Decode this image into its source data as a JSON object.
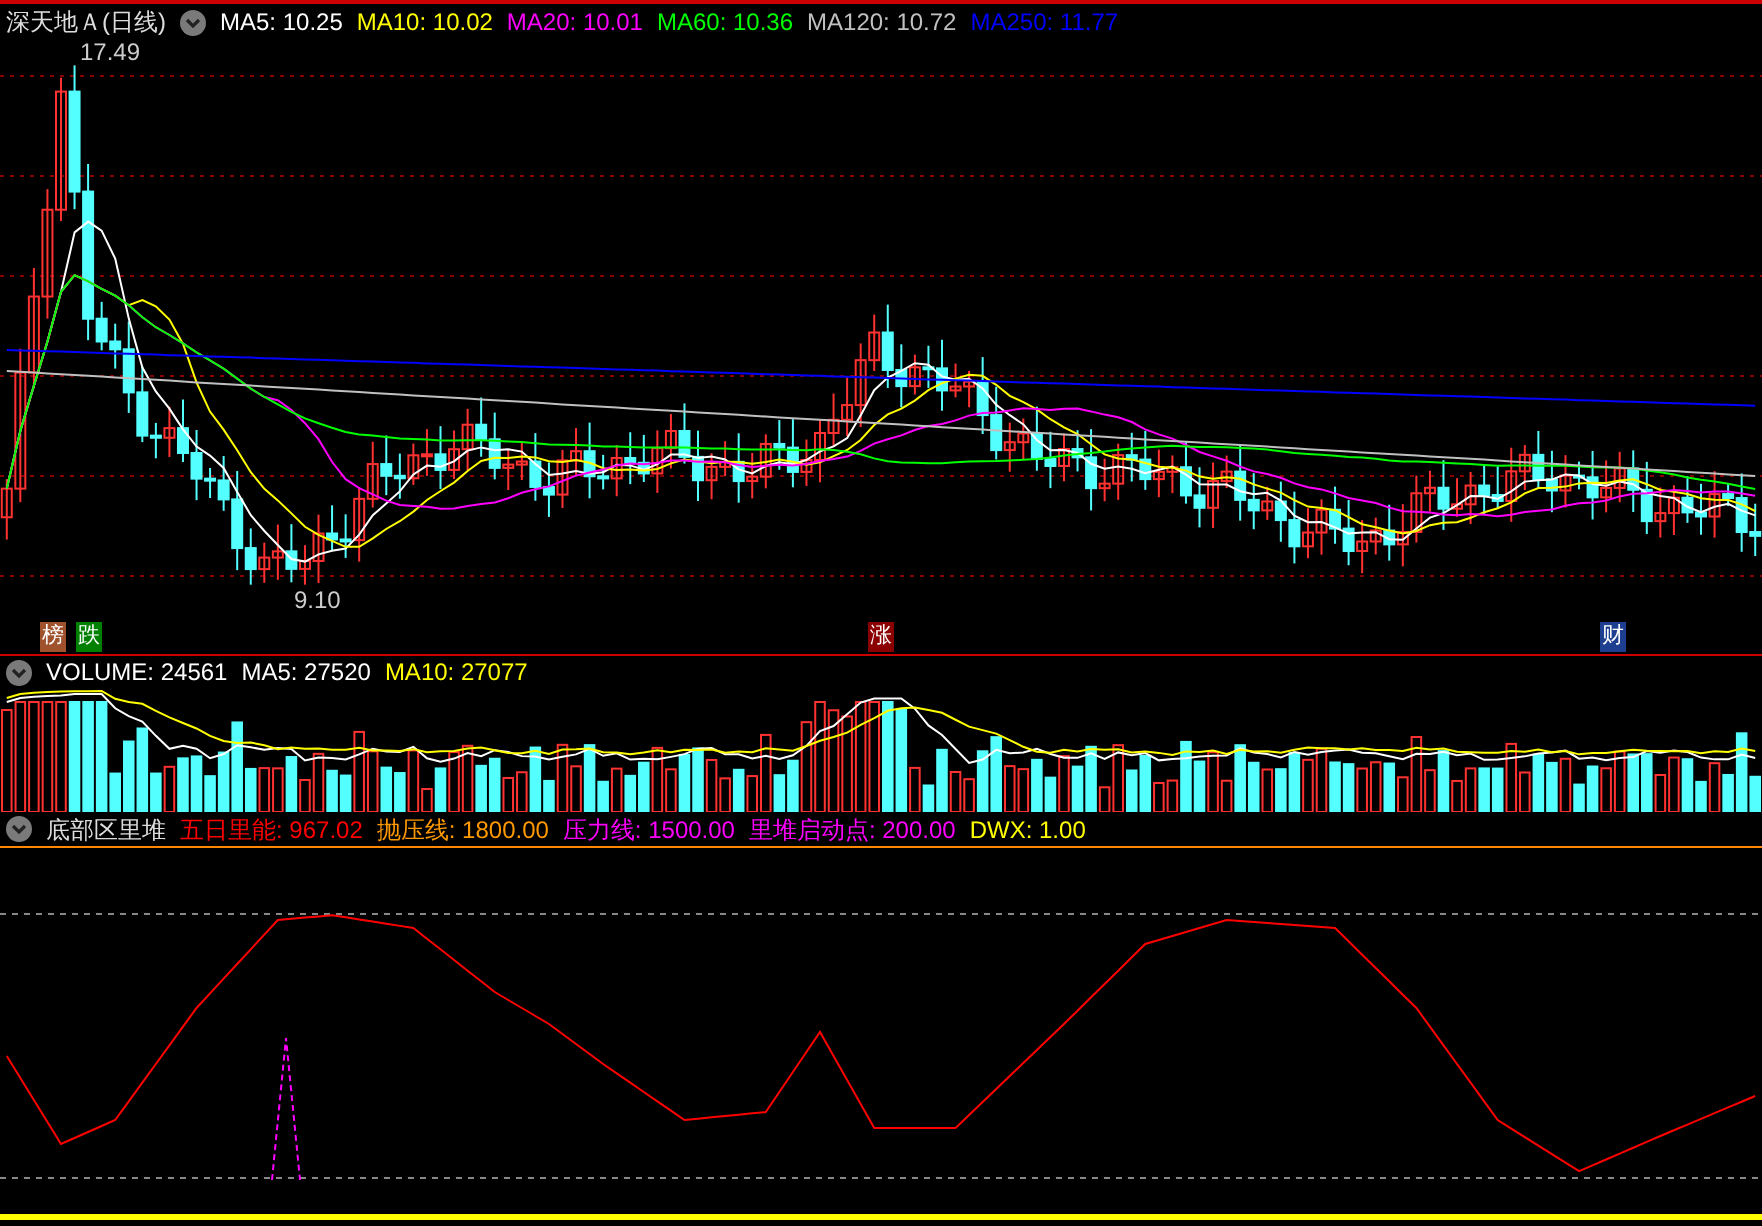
{
  "price_panel": {
    "title": "深天地Ａ(日线)",
    "indicators": [
      {
        "label": "MA5: 10.25",
        "color": "#ffffff"
      },
      {
        "label": "MA10: 10.02",
        "color": "#ffff00"
      },
      {
        "label": "MA20: 10.01",
        "color": "#ff00ff"
      },
      {
        "label": "MA60: 10.36",
        "color": "#00ff00"
      },
      {
        "label": "MA120: 10.72",
        "color": "#c0c0c0"
      },
      {
        "label": "MA250: 11.77",
        "color": "#0000ff"
      }
    ],
    "high_label": "17.49",
    "low_label": "9.10",
    "markers": [
      {
        "text": "榜",
        "color": "#a0522d"
      },
      {
        "text": "跌",
        "color": "#008000"
      },
      {
        "text": "涨",
        "color": "#8b0000"
      },
      {
        "text": "财",
        "color": "#1e3f8f"
      }
    ]
  },
  "volume_panel": {
    "indicators": [
      {
        "label": "VOLUME: 24561",
        "color": "#ffffff"
      },
      {
        "label": "MA5: 27520",
        "color": "#ffffff"
      },
      {
        "label": "MA10: 27077",
        "color": "#ffff00"
      }
    ]
  },
  "indicator_panel": {
    "title": "底部区里堆",
    "indicators": [
      {
        "label": "五日里能: 967.02",
        "color": "#ff0000"
      },
      {
        "label": "抛压线: 1800.00",
        "color": "#ff9900"
      },
      {
        "label": "压力线: 1500.00",
        "color": "#ff00ff"
      },
      {
        "label": "里堆启动点: 200.00",
        "color": "#ff00ff"
      },
      {
        "label": "DWX: 1.00",
        "color": "#ffff00"
      }
    ]
  }
}
